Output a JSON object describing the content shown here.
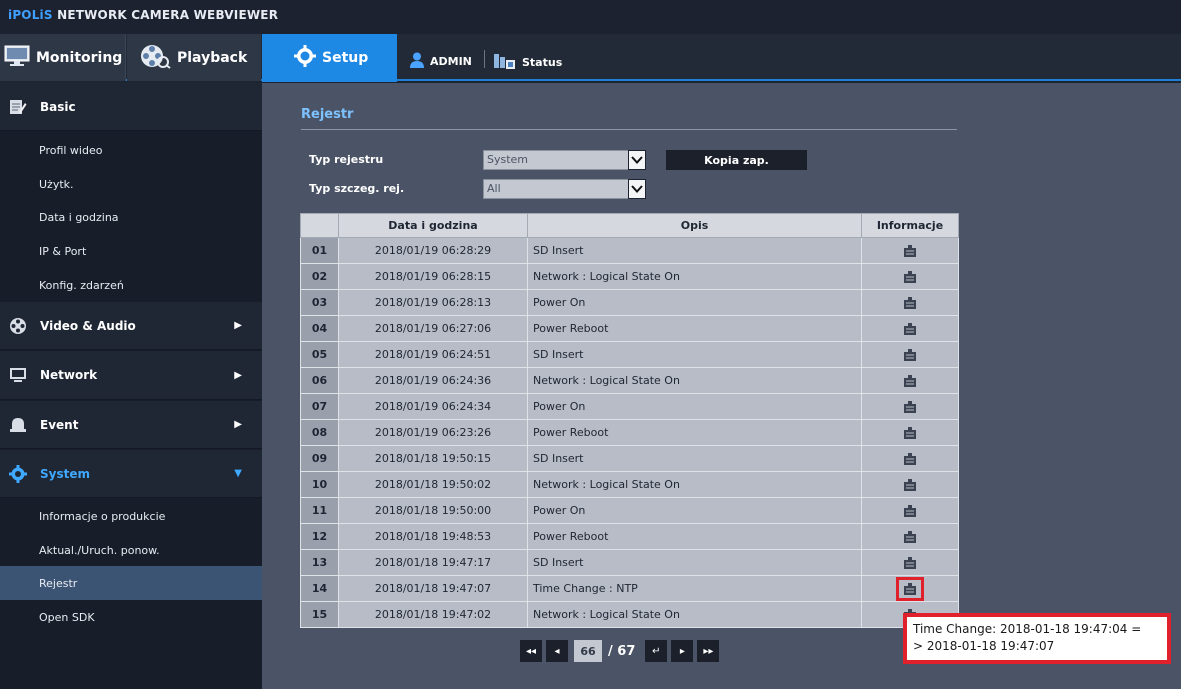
{
  "brand": {
    "prefix": "iPOLiS",
    "title": " NETWORK CAMERA WEBVIEWER"
  },
  "nav": {
    "monitoring": "Monitoring",
    "playback": "Playback",
    "setup": "Setup",
    "admin": "ADMIN",
    "status": "Status"
  },
  "sidebar": {
    "basic": {
      "label": "Basic",
      "icon": "edit-icon",
      "items": [
        "Profil wideo",
        "Użytk.",
        "Data i godzina",
        "IP & Port",
        "Konfig. zdarzeń"
      ]
    },
    "video_audio": {
      "label": "Video & Audio",
      "icon": "film-reel-icon"
    },
    "network": {
      "label": "Network",
      "icon": "monitor-icon"
    },
    "event": {
      "label": "Event",
      "icon": "alarm-bell-icon"
    },
    "system": {
      "label": "System",
      "icon": "gear-icon",
      "items": [
        "Informacje o produkcie",
        "Aktual./Uruch. ponow.",
        "Rejestr",
        "Open SDK"
      ],
      "active_item": "Rejestr"
    }
  },
  "main": {
    "title": "Rejestr",
    "log_type_label": "Typ rejestru",
    "log_type_value": "System",
    "detail_type_label": "Typ szczeg. rej.",
    "detail_type_value": "All",
    "backup_label": "Kopia zap."
  },
  "table": {
    "headers": [
      "",
      "Data i godzina",
      "Opis",
      "Informacje"
    ],
    "rows": [
      {
        "num": "01",
        "datetime": "2018/01/19 06:28:29",
        "desc": "SD Insert"
      },
      {
        "num": "02",
        "datetime": "2018/01/19 06:28:15",
        "desc": "Network : Logical State On"
      },
      {
        "num": "03",
        "datetime": "2018/01/19 06:28:13",
        "desc": "Power On"
      },
      {
        "num": "04",
        "datetime": "2018/01/19 06:27:06",
        "desc": "Power Reboot"
      },
      {
        "num": "05",
        "datetime": "2018/01/19 06:24:51",
        "desc": "SD Insert"
      },
      {
        "num": "06",
        "datetime": "2018/01/19 06:24:36",
        "desc": "Network : Logical State On"
      },
      {
        "num": "07",
        "datetime": "2018/01/19 06:24:34",
        "desc": "Power On"
      },
      {
        "num": "08",
        "datetime": "2018/01/19 06:23:26",
        "desc": "Power Reboot"
      },
      {
        "num": "09",
        "datetime": "2018/01/18 19:50:15",
        "desc": "SD Insert"
      },
      {
        "num": "10",
        "datetime": "2018/01/18 19:50:02",
        "desc": "Network : Logical State On"
      },
      {
        "num": "11",
        "datetime": "2018/01/18 19:50:00",
        "desc": "Power On"
      },
      {
        "num": "12",
        "datetime": "2018/01/18 19:48:53",
        "desc": "Power Reboot"
      },
      {
        "num": "13",
        "datetime": "2018/01/18 19:47:17",
        "desc": "SD Insert"
      },
      {
        "num": "14",
        "datetime": "2018/01/18 19:47:07",
        "desc": "Time Change : NTP",
        "highlighted": true
      },
      {
        "num": "15",
        "datetime": "2018/01/18 19:47:02",
        "desc": "Network : Logical State On"
      }
    ]
  },
  "pager": {
    "current": "66",
    "total": "/ 67"
  },
  "tooltip": {
    "line1": "Time Change: 2018-01-18 19:47:04 =",
    "line2": "> 2018-01-18 19:47:07"
  },
  "colors": {
    "accent": "#1e88e5",
    "highlight": "#e0202a",
    "title": "#7ec1ff"
  }
}
